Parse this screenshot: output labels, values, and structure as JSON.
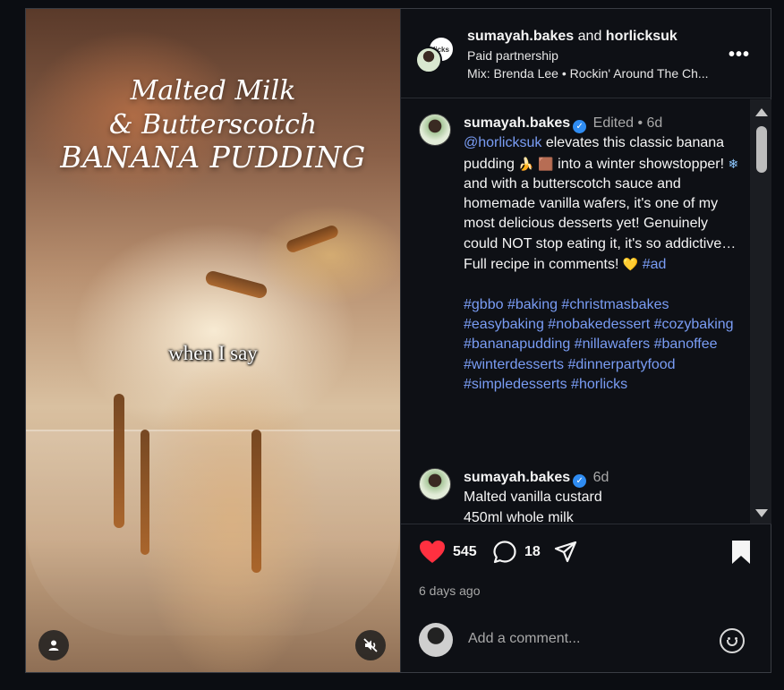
{
  "media": {
    "overlay_title_line1": "Malted Milk",
    "overlay_title_line2": "& Butterscotch",
    "overlay_title_line3": "BANANA PUDDING",
    "caption": "when I say"
  },
  "header": {
    "author": "sumayah.bakes",
    "and": "and",
    "partner": "horlicksuk",
    "partner_avatar_text": "licks",
    "paid_label": "Paid partnership",
    "audio": "Mix: Brenda Lee • Rockin' Around The Ch...",
    "more_label": "•••"
  },
  "post": {
    "author": "sumayah.bakes",
    "edited": "Edited",
    "dot": "•",
    "age": "6d",
    "mention": "@horlicksuk",
    "text_1": " elevates this classic banana pudding ",
    "emoji_1": "🍌",
    "emoji_2": "🟫",
    "text_2": " into a winter showstopper! ",
    "emoji_3": "❄",
    "text_3": " and with a butterscotch sauce and homemade vanilla wafers, it's one of my most delicious desserts yet! Genuinely could NOT stop eating it, it's so addictive… Full recipe in comments! ",
    "emoji_4": "💛",
    "ad_tag": "#ad",
    "hashtags": "#gbbo #baking #christmasbakes #easybaking #nobakedessert #cozybaking #bananapudding #nillawafers #banoffee #winterdesserts #dinnerpartyfood #simpledesserts #horlicks"
  },
  "comment": {
    "author": "sumayah.bakes",
    "age": "6d",
    "line_1": "Malted vanilla custard",
    "line_2": "450ml whole milk"
  },
  "actions": {
    "likes": "545",
    "comments": "18",
    "posted_ago": "6 days ago"
  },
  "add_comment": {
    "placeholder": "Add a comment..."
  },
  "colors": {
    "like_red": "#ff3040",
    "link_blue": "#7a9df5",
    "verified_blue": "#2f8cf2"
  },
  "icons": [
    "user-tag-icon",
    "mute-icon",
    "more-icon",
    "verified-icon",
    "heart-icon",
    "comment-icon",
    "share-icon",
    "bookmark-icon",
    "emoji-icon"
  ]
}
